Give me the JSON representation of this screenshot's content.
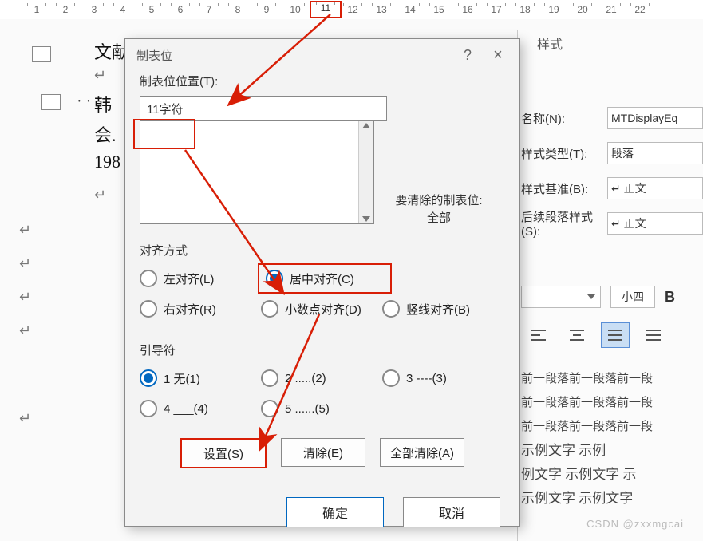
{
  "ruler": {
    "ticks": [
      1,
      2,
      3,
      4,
      5,
      6,
      7,
      8,
      9,
      10,
      11,
      12,
      13,
      14,
      15,
      16,
      17,
      18,
      19,
      20,
      21,
      22
    ],
    "highlight": 11
  },
  "doc": {
    "line1": "文献起止页码",
    "line2": "韩",
    "line3": "会.",
    "line4": "198"
  },
  "dialog": {
    "title": "制表位",
    "help_icon": "?",
    "close_icon": "×",
    "pos_label": "制表位位置(T):",
    "pos_value": "11字符",
    "default_clear_label": "要清除的制表位:",
    "default_clear_value": "全部",
    "align": {
      "title": "对齐方式",
      "options": [
        "左对齐(L)",
        "居中对齐(C)",
        "右对齐(R)",
        "小数点对齐(D)",
        "竖线对齐(B)"
      ],
      "selected": 1
    },
    "leader": {
      "title": "引导符",
      "options": [
        "1 无(1)",
        "2 .....(2)",
        "3 ----(3)",
        "4 ___(4)",
        "5 ......(5)"
      ],
      "selected": 0
    },
    "buttons": {
      "set": "设置(S)",
      "clear": "清除(E)",
      "clear_all": "全部清除(A)"
    },
    "footer": {
      "ok": "确定",
      "cancel": "取消"
    }
  },
  "panel": {
    "header": "样式",
    "name_lbl": "名称(N):",
    "name_val": "MTDisplayEq",
    "type_lbl": "样式类型(T):",
    "type_val": "段落",
    "base_lbl": "样式基准(B):",
    "base_val": "↵ 正文",
    "para_lbl": "后续段落样式(S):",
    "para_val": "↵ 正文",
    "size": "小四",
    "preview": [
      "前一段落前一段落前一段",
      "前一段落前一段落前一段",
      "前一段落前一段落前一段",
      "示例文字  示例",
      "例文字  示例文字  示",
      "示例文字  示例文字"
    ]
  },
  "watermark": "CSDN @zxxmgcai"
}
